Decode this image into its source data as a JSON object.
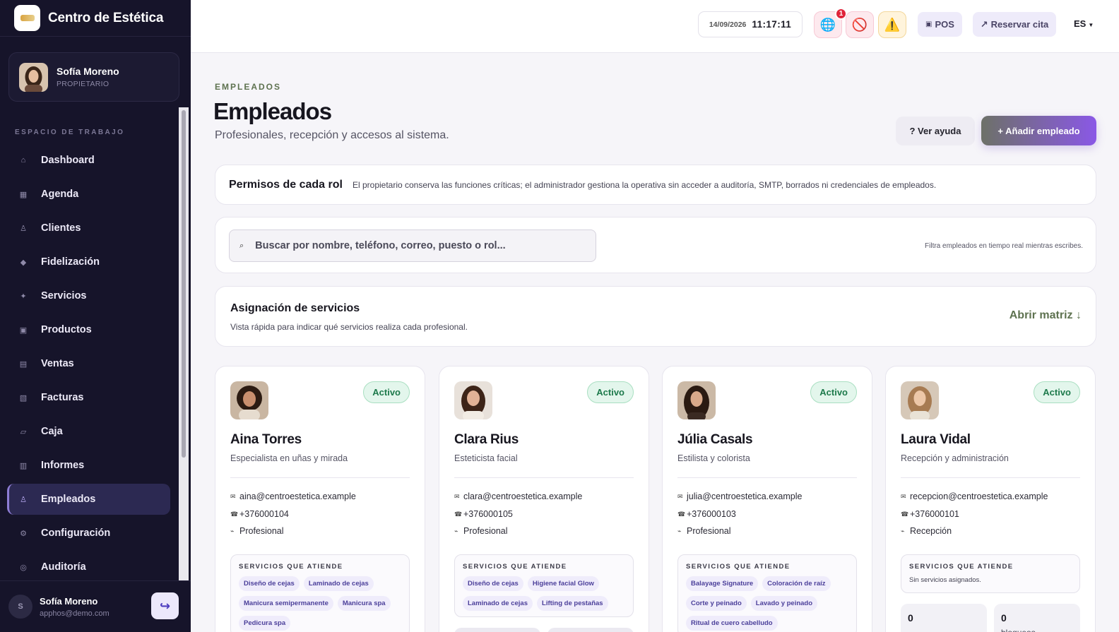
{
  "brand": {
    "name": "Centro de Estética"
  },
  "user": {
    "name": "Sofía Moreno",
    "role": "PROPIETARIO",
    "email": "apphos@demo.com",
    "initial": "S"
  },
  "sidebar": {
    "section_label": "ESPACIO DE TRABAJO",
    "items": [
      {
        "label": "Dashboard",
        "icon": "⌂"
      },
      {
        "label": "Agenda",
        "icon": "▦"
      },
      {
        "label": "Clientes",
        "icon": "♙"
      },
      {
        "label": "Fidelización",
        "icon": "◆"
      },
      {
        "label": "Servicios",
        "icon": "✦"
      },
      {
        "label": "Productos",
        "icon": "▣"
      },
      {
        "label": "Ventas",
        "icon": "▤"
      },
      {
        "label": "Facturas",
        "icon": "▧"
      },
      {
        "label": "Caja",
        "icon": "▱"
      },
      {
        "label": "Informes",
        "icon": "▥"
      },
      {
        "label": "Empleados",
        "icon": "♙",
        "active": true
      },
      {
        "label": "Configuración",
        "icon": "⚙"
      },
      {
        "label": "Auditoría",
        "icon": "◎"
      }
    ]
  },
  "header": {
    "date": "14/09/2026",
    "time": "11:17:11",
    "notification_count": "1",
    "pos_label": "POS",
    "pos_icon": "▣",
    "reserve_label": "Reservar cita",
    "reserve_icon": "↗",
    "language": "ES"
  },
  "page": {
    "eyebrow": "EMPLEADOS",
    "title": "Empleados",
    "subtitle": "Profesionales, recepción y accesos al sistema.",
    "help_label": "? Ver ayuda",
    "add_label": "+ Añadir empleado"
  },
  "permissions": {
    "title": "Permisos de cada rol",
    "text": "El propietario conserva las funciones críticas; el administrador gestiona la operativa sin acceder a auditoría, SMTP, borrados ni credenciales de empleados."
  },
  "search": {
    "placeholder": "Buscar por nombre, teléfono, correo, puesto o rol...",
    "hint": "Filtra empleados en tiempo real mientras escribes."
  },
  "assignment": {
    "title": "Asignación de servicios",
    "text": "Vista rápida para indicar qué servicios realiza cada profesional.",
    "link": "Abrir matriz ↓"
  },
  "services_heading": "SERVICIOS QUE ATIENDE",
  "employees": [
    {
      "name": "Aina Torres",
      "role": "Especialista en uñas y mirada",
      "status": "Activo",
      "email": "aina@centroestetica.example",
      "phone": "+376000104",
      "type": "Profesional",
      "services": [
        "Diseño de cejas",
        "Laminado de cejas",
        "Manicura semipermanente",
        "Manicura spa",
        "Pedicura spa"
      ]
    },
    {
      "name": "Clara Rius",
      "role": "Esteticista facial",
      "status": "Activo",
      "email": "clara@centroestetica.example",
      "phone": "+376000105",
      "type": "Profesional",
      "services": [
        "Diseño de cejas",
        "Higiene facial Glow",
        "Laminado de cejas",
        "Lifting de pestañas"
      ]
    },
    {
      "name": "Júlia Casals",
      "role": "Estilista y colorista",
      "status": "Activo",
      "email": "julia@centroestetica.example",
      "phone": "+376000103",
      "type": "Profesional",
      "services": [
        "Balayage Signature",
        "Coloración de raíz",
        "Corte y peinado",
        "Lavado y peinado",
        "Ritual de cuero cabelludo"
      ]
    },
    {
      "name": "Laura Vidal",
      "role": "Recepción y administración",
      "status": "Activo",
      "email": "recepcion@centroestetica.example",
      "phone": "+376000101",
      "type": "Recepción",
      "services": [],
      "no_services": "Sin servicios asignados.",
      "stats": [
        {
          "value": "0",
          "label": ""
        },
        {
          "value": "0",
          "label": "bloqueos"
        }
      ]
    }
  ],
  "icons": {
    "email": "✉",
    "phone": "☎",
    "type": "⌁",
    "search": "⌕",
    "logout": "↪",
    "globe": "🌐",
    "block": "🚫",
    "warning": "⚠️"
  }
}
